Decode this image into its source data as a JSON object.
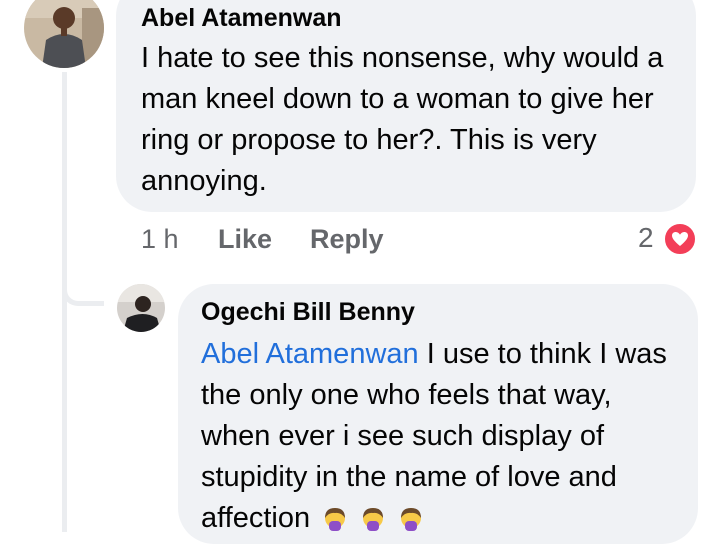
{
  "comment": {
    "author": "Abel Atamenwan",
    "text": "I hate to see this nonsense, why would a man kneel down to a woman to give her ring or propose to her?. This is very annoying.",
    "time": "1 h",
    "like_label": "Like",
    "reply_label": "Reply",
    "reaction_count": "2",
    "reaction_icon": "heart-icon"
  },
  "reply": {
    "author": "Ogechi Bill Benny",
    "mention": "Abel Atamenwan",
    "text": "I use to think I was the only one who feels that way, when ever i see such display of stupidity in the name of love and affection",
    "emoji_icons": [
      "face-with-hand-over-mouth-icon",
      "face-with-hand-over-mouth-icon",
      "face-with-hand-over-mouth-icon"
    ]
  },
  "colors": {
    "bubble": "#f0f2f5",
    "mention": "#216fdb",
    "meta": "#65676b",
    "heart": "#f33e58"
  }
}
